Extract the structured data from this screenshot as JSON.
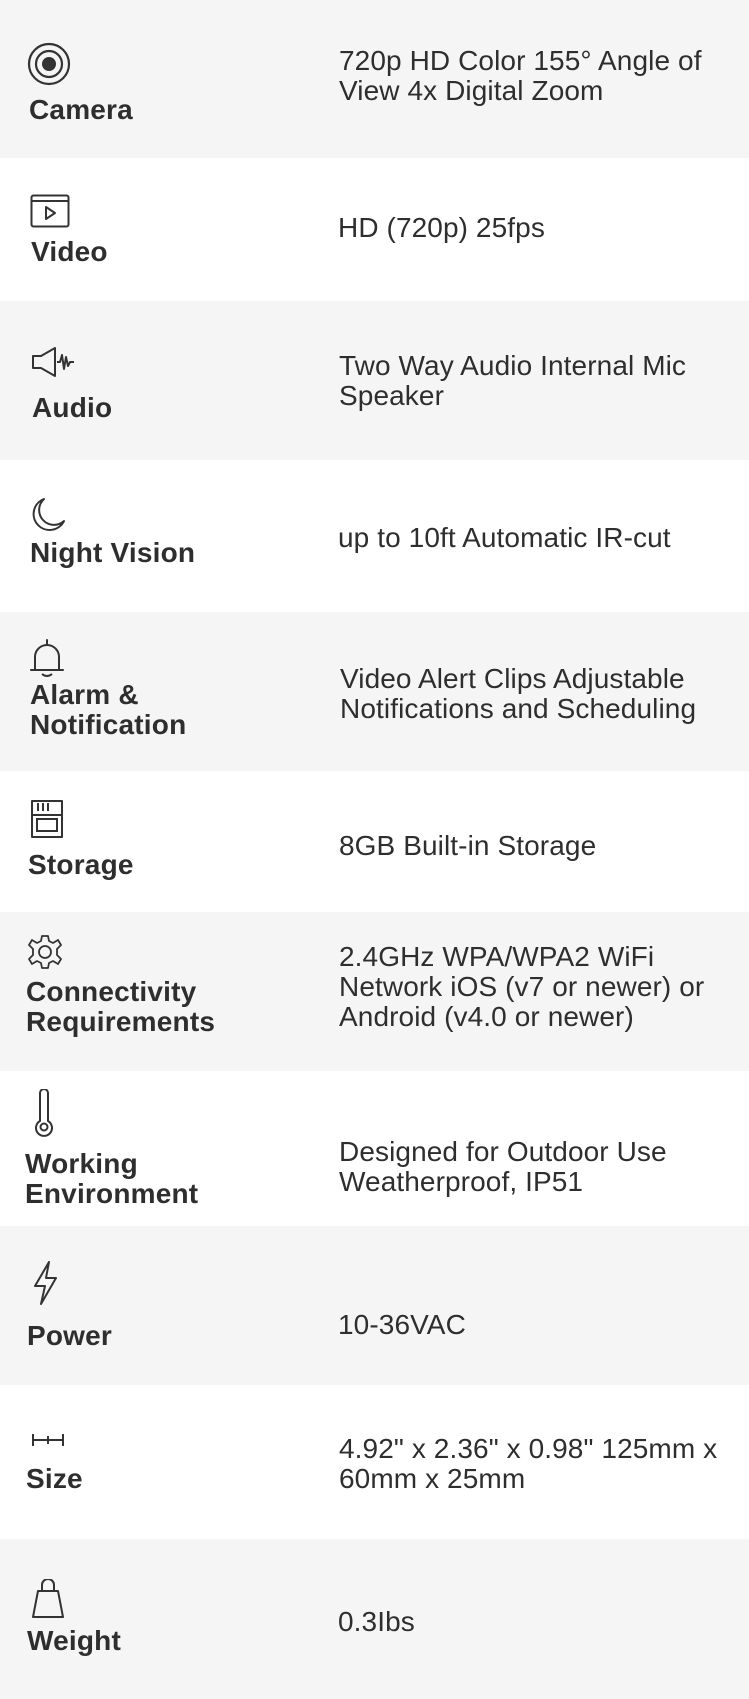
{
  "specs": [
    {
      "label": "Camera",
      "value": "720p HD Color 155° Angle of View 4x Digital Zoom",
      "icon": "camera-lens-icon",
      "shaded": true
    },
    {
      "label": "Video",
      "value": "HD (720p) 25fps",
      "icon": "video-icon",
      "shaded": false
    },
    {
      "label": "Audio",
      "value": "Two Way Audio Internal Mic Speaker",
      "icon": "speaker-icon",
      "shaded": true
    },
    {
      "label": "Night Vision",
      "value": "up to 10ft Automatic IR-cut",
      "icon": "moon-icon",
      "shaded": false
    },
    {
      "label": "Alarm & Notification",
      "value": "Video Alert Clips Adjustable Notifications and Scheduling",
      "icon": "bell-icon",
      "shaded": true
    },
    {
      "label": "Storage",
      "value": "8GB Built-in Storage",
      "icon": "sd-card-icon",
      "shaded": false
    },
    {
      "label": "Connectivity Requirements",
      "value": "2.4GHz WPA/WPA2 WiFi Network iOS (v7 or newer) or Android (v4.0 or newer)",
      "icon": "gear-icon",
      "shaded": true
    },
    {
      "label": "Working Environment",
      "value": "Designed for Outdoor Use Weatherproof, IP51",
      "icon": "thermometer-icon",
      "shaded": false
    },
    {
      "label": "Power",
      "value": "10-36VAC",
      "icon": "lightning-icon",
      "shaded": true
    },
    {
      "label": "Size",
      "value": "4.92\" x 2.36\" x 0.98\" 125mm x 60mm x 25mm",
      "icon": "ruler-icon",
      "shaded": false
    },
    {
      "label": "Weight",
      "value": "0.3Ibs",
      "icon": "weight-icon",
      "shaded": true
    }
  ],
  "colors": {
    "shaded_row": "#f5f5f5",
    "plain_row": "#ffffff",
    "text": "#2e2e2e"
  }
}
